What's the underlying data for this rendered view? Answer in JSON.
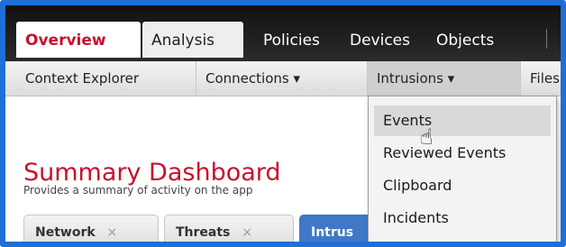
{
  "top_nav": {
    "overview": "Overview",
    "analysis": "Analysis",
    "policies": "Policies",
    "devices": "Devices",
    "objects": "Objects"
  },
  "sub_nav": {
    "context_explorer": "Context Explorer",
    "connections": "Connections ▾",
    "intrusions": "Intrusions ▾",
    "files": "Files"
  },
  "dropdown": {
    "items": [
      "Events",
      "Reviewed Events",
      "Clipboard",
      "Incidents"
    ]
  },
  "page": {
    "title": "Summary Dashboard",
    "subtitle": "Provides a summary of activity on the app"
  },
  "bottom_tabs": {
    "network": "Network",
    "threats": "Threats",
    "intrusions": "Intrus"
  },
  "close_symbol": "×",
  "cursor_symbol": "☝",
  "colors": {
    "frame": "#1f6fd6",
    "accent_red": "#c8102e",
    "active_tab_blue": "#3f78c6"
  }
}
